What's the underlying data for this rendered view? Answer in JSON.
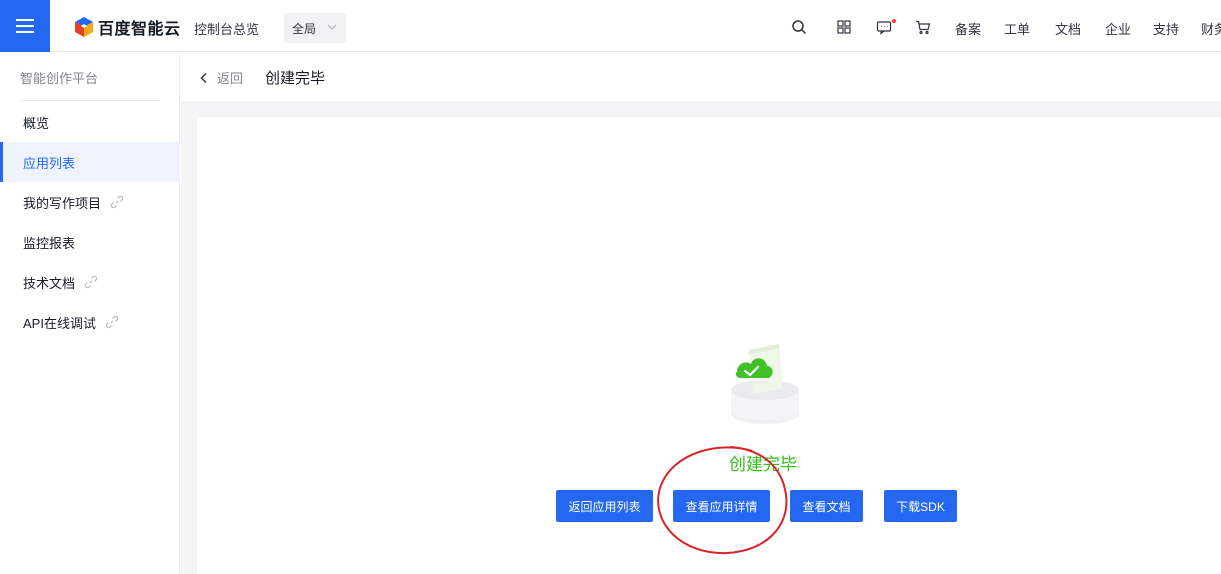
{
  "brand": {
    "name": "百度智能云",
    "accent": "#2468f2"
  },
  "topbar": {
    "console_overview": "控制台总览",
    "region": "全局",
    "icons": [
      "search-icon",
      "apps-grid-icon",
      "message-icon",
      "cart-icon"
    ],
    "links": [
      "备案",
      "工单",
      "文档",
      "企业",
      "支持",
      "财务"
    ]
  },
  "sidebar": {
    "title": "智能创作平台",
    "items": [
      {
        "label": "概览",
        "external": false,
        "active": false
      },
      {
        "label": "应用列表",
        "external": false,
        "active": true
      },
      {
        "label": "我的写作项目",
        "external": true,
        "active": false
      },
      {
        "label": "监控报表",
        "external": false,
        "active": false
      },
      {
        "label": "技术文档",
        "external": true,
        "active": false
      },
      {
        "label": "API在线调试",
        "external": true,
        "active": false
      }
    ]
  },
  "header": {
    "back_label": "返回",
    "title": "创建完毕"
  },
  "result": {
    "status_text": "创建完毕",
    "status_color": "#30bf13",
    "buttons": [
      "返回应用列表",
      "查看应用详情",
      "查看文档",
      "下载SDK"
    ]
  },
  "annotation_color": "#d8242a"
}
